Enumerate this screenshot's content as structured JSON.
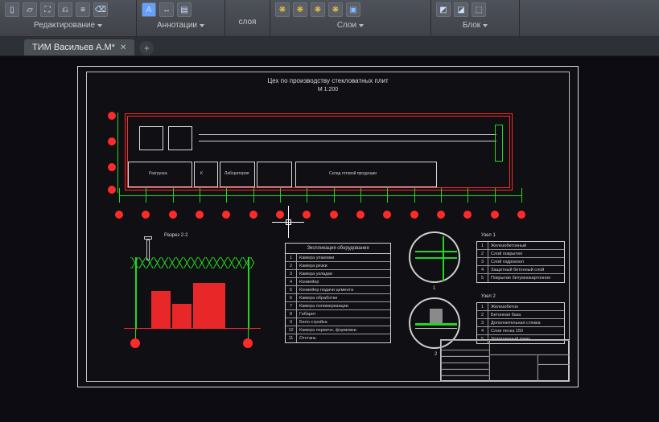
{
  "ribbon": {
    "groups": [
      {
        "label": "Редактирование"
      },
      {
        "label": "Аннотации"
      },
      {
        "label_above": "слоя",
        "label": "Слои"
      },
      {
        "label": "Блок"
      }
    ]
  },
  "tab": {
    "filename": "ТИМ Васильев А.М*"
  },
  "drawing": {
    "title": "Цех по производству стекловатных плит",
    "scale": "М 1:200",
    "section_label": "Разрез 2-2",
    "node1_label": "Узел 1",
    "node2_label": "Узел 2",
    "spec_header": "Экспликация оборудования",
    "spec_rows": [
      "Камера упаковки",
      "Камера резки",
      "Камера укладки",
      "Конвейер",
      "Конвейер подачи цемента",
      "Камера обработки",
      "Камера полимеризации",
      "Габарит",
      "Бело-стройка",
      "Камера первичн. формовки",
      "Отстань"
    ],
    "node1_rows": [
      "Железобетонный",
      "Слой покрытия",
      "Слой гидроизол",
      "Защитный бетонный слой",
      "Покрытие битумнокартонное"
    ],
    "node2_rows": [
      "Железобетон",
      "Бетонная база",
      "Дополнительная стяжка",
      "Слои песка 150",
      "Уплотненный грунт"
    ],
    "plan_rooms": [
      "Разгрузка",
      "К",
      "Лаборатория",
      "Склад готовой продукции"
    ]
  }
}
